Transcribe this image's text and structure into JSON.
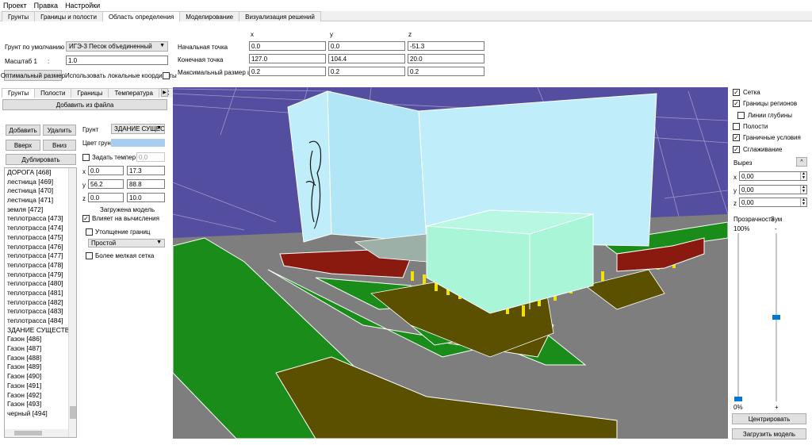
{
  "menu": [
    "Проект",
    "Правка",
    "Настройки"
  ],
  "main_tabs": [
    "Грунты",
    "Границы и полости",
    "Область определения",
    "Моделирование",
    "Визуализация решений"
  ],
  "settings": {
    "default_soil_label": "Грунт по умолчанию",
    "default_soil_value": "ИГЭ-3 Песок объединенный",
    "scale_label": "Масштаб 1",
    "scale_colon": ":",
    "scale_value": "1.0",
    "optimal_size_button": "Оптимальный размер",
    "local_coords_label": "Использовать локальные координаты"
  },
  "coords": {
    "x_header": "x",
    "y_header": "y",
    "z_header": "z",
    "start_label": "Начальная точка",
    "end_label": "Конечная точка",
    "step_label": "Максимальный размер шага",
    "start": [
      "0.0",
      "0.0",
      "-51.3"
    ],
    "end": [
      "127.0",
      "104.4",
      "20.0"
    ],
    "step": [
      "0.2",
      "0.2",
      "0.2"
    ]
  },
  "subtabs": [
    "Грунты",
    "Полости",
    "Границы",
    "Температура",
    "С"
  ],
  "left": {
    "add_from_file": "Добавить из файла",
    "add": "Добавить",
    "delete": "Удалить",
    "up": "Вверх",
    "down": "Вниз",
    "duplicate": "Дублировать"
  },
  "list_items": [
    "ДОРОГА [468]",
    "лестница [469]",
    "лестница [470]",
    "лестница [471]",
    "земля [472]",
    "теплотрасса [473]",
    "теплотрасса [474]",
    "теплотрасса [475]",
    "теплотрасса [476]",
    "теплотрасса [477]",
    "теплотрасса [478]",
    "теплотрасса [479]",
    "теплотрасса [480]",
    "теплотрасса [481]",
    "теплотрасса [482]",
    "теплотрасса [483]",
    "теплотрасса [484]",
    "ЗДАНИЕ СУЩЕСТВУЮ",
    "Газон [486]",
    "Газон [487]",
    "Газон [488]",
    "Газон [489]",
    "Газон [490]",
    "Газон [491]",
    "Газон [492]",
    "Газон [493]",
    "черный [494]"
  ],
  "props": {
    "soil_label": "Грунт",
    "soil_value": "ЗДАНИЕ СУЩЕСТ",
    "color_label": "Цвет грун",
    "color_value": "#a9cdf0",
    "temp_label": "Задать темпер",
    "temp_value": "0.0",
    "x_label": "x",
    "x_min": "0.0",
    "x_max": "17.3",
    "y_label": "y",
    "y_min": "56.2",
    "y_max": "88.8",
    "z_label": "z",
    "z_min": "0.0",
    "z_max": "10.0",
    "model_loaded": "Загружена модель",
    "affects_calc": "Влияет на вычисления",
    "boundary_thickening": "Утолщение границ",
    "mode_value": "Простой",
    "finer_grid": "Более мелкая сетка"
  },
  "right": {
    "grid": "Сетка",
    "region_borders": "Границы регионов",
    "depth_lines": "Линии глубины",
    "cavities": "Полости",
    "boundary_conditions": "Граничные условия",
    "smoothing": "Сглаживание",
    "cut_label": "Вырез",
    "cut_x_label": "x",
    "cut_x": "0,00",
    "cut_y_label": "y",
    "cut_y": "0,00",
    "cut_z_label": "z",
    "cut_z": "0,00",
    "transparency_label": "Прозрачность",
    "zoom_label": "Зум",
    "pct_top": "100%",
    "pct_bottom": "0%",
    "zoom_minus": "-",
    "zoom_plus": "+",
    "transparency_level": 0.0,
    "zoom_level": 0.5,
    "center_button": "Центрировать",
    "load_model_button": "Загрузить модель"
  },
  "colors": {
    "sky": "#544ea0",
    "ground": "#7e7e7e",
    "grass": "#1a8c1a",
    "soil": "#5a5000",
    "building": "#bfeefa",
    "building2": "#a8f5d8",
    "pipe": "#8a1a10",
    "pile": "#f2e200"
  }
}
